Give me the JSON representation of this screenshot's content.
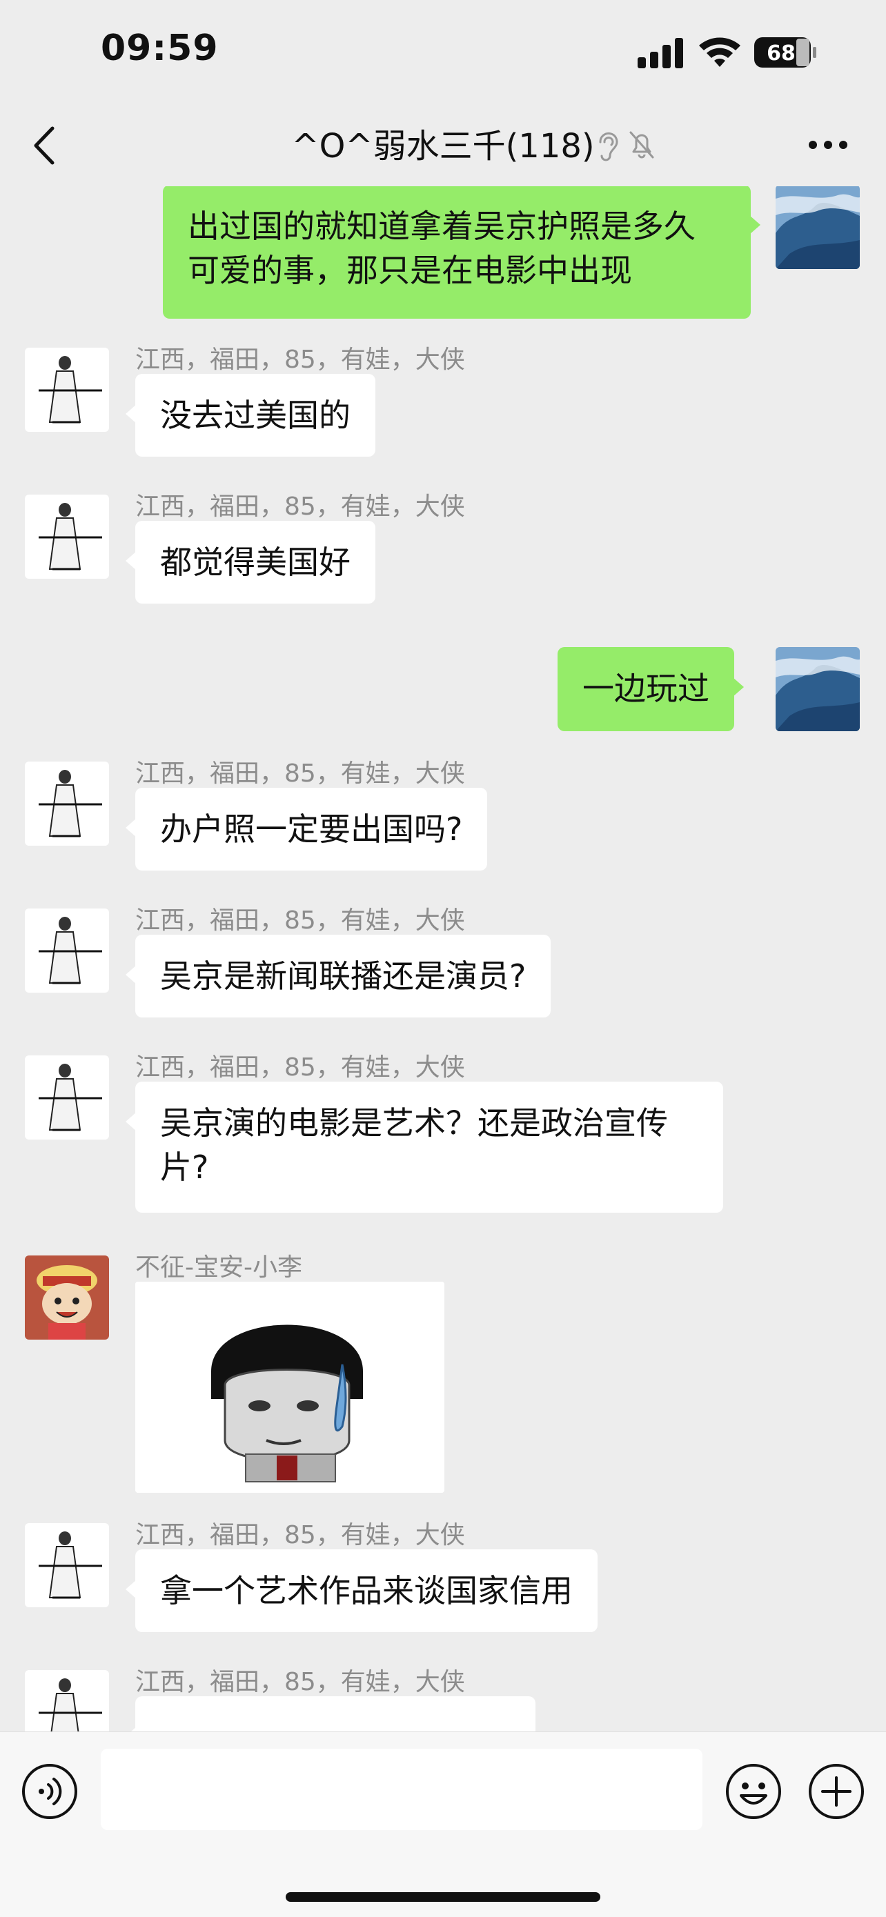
{
  "status_bar": {
    "time": "09:59",
    "battery_level": "68"
  },
  "nav": {
    "title": "^O^弱水三千(118)"
  },
  "messages": [
    {
      "side": "out",
      "text": "出过国的就知道拿着吴京护照是多久可爱的事，那只是在电影中出现"
    },
    {
      "side": "in",
      "sender": "江西，福田，85，有娃，大侠",
      "text": "没去过美国的"
    },
    {
      "side": "in",
      "sender": "江西，福田，85，有娃，大侠",
      "text": "都觉得美国好"
    },
    {
      "side": "out",
      "text": "一边玩过"
    },
    {
      "side": "in",
      "sender": "江西，福田，85，有娃，大侠",
      "text": "办户照一定要出国吗?"
    },
    {
      "side": "in",
      "sender": "江西，福田，85，有娃，大侠",
      "text": "吴京是新闻联播还是演员?"
    },
    {
      "side": "in",
      "sender": "江西，福田，85，有娃，大侠",
      "text": "吴京演的电影是艺术？还是政治宣传片?"
    },
    {
      "side": "in",
      "sender": "不征-宝安-小李",
      "type": "sticker"
    },
    {
      "side": "in",
      "sender": "江西，福田，85，有娃，大侠",
      "text": "拿一个艺术作品来谈国家信用"
    },
    {
      "side": "in",
      "sender": "江西，福田，85，有娃，大侠",
      "text": ""
    }
  ],
  "input": {
    "value": ""
  },
  "colors": {
    "background": "#ededed",
    "bubble_out": "#95ec69",
    "bubble_in": "#ffffff"
  }
}
